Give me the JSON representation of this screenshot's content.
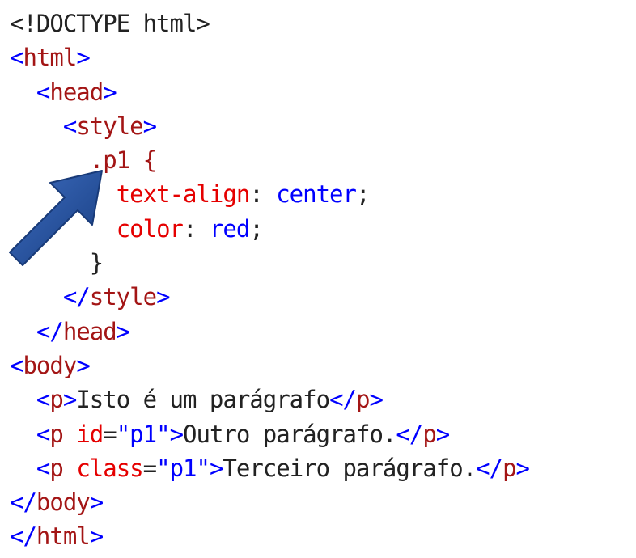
{
  "code": {
    "lines": [
      [
        {
          "t": "<!DOCTYPE html>",
          "k": "tb"
        }
      ],
      [
        {
          "t": "<",
          "k": "vl"
        },
        {
          "t": "html",
          "k": "tg"
        },
        {
          "t": ">",
          "k": "vl"
        }
      ],
      [
        {
          "t": "  ",
          "k": "tb"
        },
        {
          "t": "<",
          "k": "vl"
        },
        {
          "t": "head",
          "k": "tg"
        },
        {
          "t": ">",
          "k": "vl"
        }
      ],
      [
        {
          "t": "    ",
          "k": "tb"
        },
        {
          "t": "<",
          "k": "vl"
        },
        {
          "t": "style",
          "k": "tg"
        },
        {
          "t": ">",
          "k": "vl"
        }
      ],
      [
        {
          "t": "      .p1 {",
          "k": "tg"
        }
      ],
      [
        {
          "t": "        ",
          "k": "tb"
        },
        {
          "t": "text-align",
          "k": "pr"
        },
        {
          "t": ": ",
          "k": "tb"
        },
        {
          "t": "center",
          "k": "vl"
        },
        {
          "t": ";",
          "k": "tb"
        }
      ],
      [
        {
          "t": "        ",
          "k": "tb"
        },
        {
          "t": "color",
          "k": "pr"
        },
        {
          "t": ": ",
          "k": "tb"
        },
        {
          "t": "red",
          "k": "vl"
        },
        {
          "t": ";",
          "k": "tb"
        }
      ],
      [
        {
          "t": "      }",
          "k": "tb"
        }
      ],
      [
        {
          "t": "    ",
          "k": "tb"
        },
        {
          "t": "</",
          "k": "vl"
        },
        {
          "t": "style",
          "k": "tg"
        },
        {
          "t": ">",
          "k": "vl"
        }
      ],
      [
        {
          "t": "  ",
          "k": "tb"
        },
        {
          "t": "</",
          "k": "vl"
        },
        {
          "t": "head",
          "k": "tg"
        },
        {
          "t": ">",
          "k": "vl"
        }
      ],
      [
        {
          "t": "<",
          "k": "vl"
        },
        {
          "t": "body",
          "k": "tg"
        },
        {
          "t": ">",
          "k": "vl"
        }
      ],
      [
        {
          "t": "  ",
          "k": "tb"
        },
        {
          "t": "<",
          "k": "vl"
        },
        {
          "t": "p",
          "k": "tg"
        },
        {
          "t": ">",
          "k": "vl"
        },
        {
          "t": "Isto é um parágrafo",
          "k": "tb"
        },
        {
          "t": "</",
          "k": "vl"
        },
        {
          "t": "p",
          "k": "tg"
        },
        {
          "t": ">",
          "k": "vl"
        }
      ],
      [
        {
          "t": "  ",
          "k": "tb"
        },
        {
          "t": "<",
          "k": "vl"
        },
        {
          "t": "p",
          "k": "tg"
        },
        {
          "t": " ",
          "k": "tb"
        },
        {
          "t": "id",
          "k": "pr"
        },
        {
          "t": "=",
          "k": "tb"
        },
        {
          "t": "\"p1\"",
          "k": "vl"
        },
        {
          "t": ">",
          "k": "vl"
        },
        {
          "t": "Outro parágrafo.",
          "k": "tb"
        },
        {
          "t": "</",
          "k": "vl"
        },
        {
          "t": "p",
          "k": "tg"
        },
        {
          "t": ">",
          "k": "vl"
        }
      ],
      [
        {
          "t": "  ",
          "k": "tb"
        },
        {
          "t": "<",
          "k": "vl"
        },
        {
          "t": "p",
          "k": "tg"
        },
        {
          "t": " ",
          "k": "tb"
        },
        {
          "t": "class",
          "k": "pr"
        },
        {
          "t": "=",
          "k": "tb"
        },
        {
          "t": "\"p1\"",
          "k": "vl"
        },
        {
          "t": ">",
          "k": "vl"
        },
        {
          "t": "Terceiro parágrafo.",
          "k": "tb"
        },
        {
          "t": "</",
          "k": "vl"
        },
        {
          "t": "p",
          "k": "tg"
        },
        {
          "t": ">",
          "k": "vl"
        }
      ],
      [
        {
          "t": "</",
          "k": "vl"
        },
        {
          "t": "body",
          "k": "tg"
        },
        {
          "t": ">",
          "k": "vl"
        }
      ],
      [
        {
          "t": "</",
          "k": "vl"
        },
        {
          "t": "html",
          "k": "tg"
        },
        {
          "t": ">",
          "k": "vl"
        }
      ]
    ]
  },
  "colors": {
    "text": "#222222",
    "tag": "#a31515",
    "property": "#e50000",
    "value": "#0000ff",
    "arrow": "#1f4e9c"
  },
  "annotation": {
    "icon": "arrow-icon",
    "points_to_line": 5
  }
}
